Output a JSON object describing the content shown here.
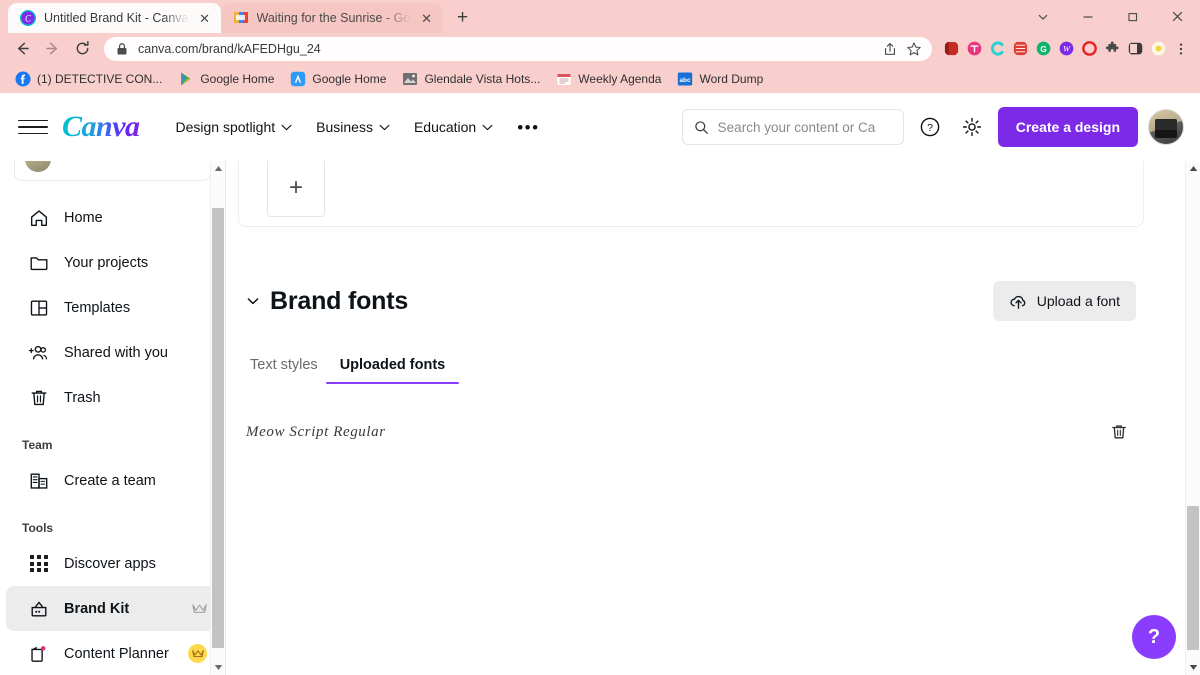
{
  "browser": {
    "tabs": [
      {
        "title": "Untitled Brand Kit - Canva",
        "favicon": "canva-icon",
        "active": true
      },
      {
        "title": "Waiting for the Sunrise - Google",
        "favicon": "google-slides-icon",
        "active": false
      }
    ],
    "new_tab_label": "+",
    "window_controls": {
      "minimize_group": "⌄",
      "minimize": "–",
      "maximize": "❐",
      "close": "✕"
    },
    "toolbar": {
      "back": "←",
      "forward": "→",
      "reload": "⟳",
      "lock_icon": "lock-icon",
      "url": "canva.com/brand/kAFEDHgu_24",
      "share_icon": "share-icon",
      "bookmark_icon": "star-icon",
      "menu_icon": "kebab-menu-icon"
    },
    "extensions": [
      {
        "name": "red-book-extension",
        "color": "#c32b23"
      },
      {
        "name": "pink-t-extension",
        "color": "#e8357f"
      },
      {
        "name": "teal-c-extension",
        "color": "#2ad4d4"
      },
      {
        "name": "red-stripes-extension",
        "color": "#e03c31"
      },
      {
        "name": "green-g-extension",
        "color": "#11b36c"
      },
      {
        "name": "purple-w-extension",
        "color": "#7d2ae8"
      },
      {
        "name": "red-o-extension",
        "color": "#e8202a"
      },
      {
        "name": "puzzle-extension",
        "color": "#4a4a4a"
      },
      {
        "name": "sidepanel-extension",
        "color": "#3a3a3a"
      },
      {
        "name": "yellow-profile-extension",
        "color": "#f6e27a"
      }
    ],
    "bookmarks": [
      {
        "label": "(1) DETECTIVE CON...",
        "icon": "facebook-icon",
        "color": "#1877f2"
      },
      {
        "label": "Google Home",
        "icon": "play-store-icon",
        "color": "#34a853"
      },
      {
        "label": "Google Home",
        "icon": "appstore-icon",
        "color": "#2f9bf5"
      },
      {
        "label": "Glendale Vista Hots...",
        "icon": "photo-icon",
        "color": "#8a8a8a"
      },
      {
        "label": "Weekly Agenda",
        "icon": "calendar-icon",
        "color": "#e8757e"
      },
      {
        "label": "Word Dump",
        "icon": "abc-icon",
        "color": "#1a6fd4"
      }
    ]
  },
  "canva": {
    "header": {
      "menu_icon": "hamburger-icon",
      "logo": "Canva",
      "nav": [
        {
          "label": "Design spotlight",
          "has_chevron": true
        },
        {
          "label": "Business",
          "has_chevron": true
        },
        {
          "label": "Education",
          "has_chevron": true
        }
      ],
      "more_label": "•••",
      "search_placeholder": "Search your content or Ca",
      "help_icon": "question-circle-icon",
      "settings_icon": "gear-icon",
      "create_button": "Create a design",
      "avatar": "user-avatar"
    },
    "sidebar": {
      "profile_name": "",
      "items": [
        {
          "label": "Home",
          "icon": "home-icon",
          "active": false,
          "badge": ""
        },
        {
          "label": "Your projects",
          "icon": "folder-icon",
          "active": false,
          "badge": ""
        },
        {
          "label": "Templates",
          "icon": "templates-icon",
          "active": false,
          "badge": ""
        },
        {
          "label": "Shared with you",
          "icon": "shared-people-icon",
          "active": false,
          "badge": ""
        },
        {
          "label": "Trash",
          "icon": "trash-icon",
          "active": false,
          "badge": ""
        }
      ],
      "team_section_label": "Team",
      "team_items": [
        {
          "label": "Create a team",
          "icon": "team-icon",
          "active": false,
          "badge": ""
        }
      ],
      "tools_section_label": "Tools",
      "tools_items": [
        {
          "label": "Discover apps",
          "icon": "apps-grid-icon",
          "active": false,
          "badge": ""
        },
        {
          "label": "Brand Kit",
          "icon": "brand-kit-icon",
          "active": true,
          "badge": "crown-icon"
        },
        {
          "label": "Content Planner",
          "icon": "content-planner-icon",
          "active": false,
          "badge": "crown-gold-icon"
        }
      ]
    },
    "main": {
      "add_color_tile": "+",
      "section": {
        "collapse_icon": "chevron-down-icon",
        "title": "Brand fonts",
        "upload_icon": "upload-cloud-icon",
        "upload_label": "Upload a font"
      },
      "tabs": [
        {
          "label": "Text styles",
          "active": false
        },
        {
          "label": "Uploaded fonts",
          "active": true
        }
      ],
      "fonts": [
        {
          "name": "Meow Script Regular",
          "delete_icon": "trash-icon"
        }
      ],
      "help_fab": "?"
    }
  },
  "colors": {
    "accent_purple": "#7d2ae8",
    "tab_underline": "#8b3dff",
    "browser_chrome": "#f8cfcc",
    "sidebar_active": "#ececed"
  }
}
